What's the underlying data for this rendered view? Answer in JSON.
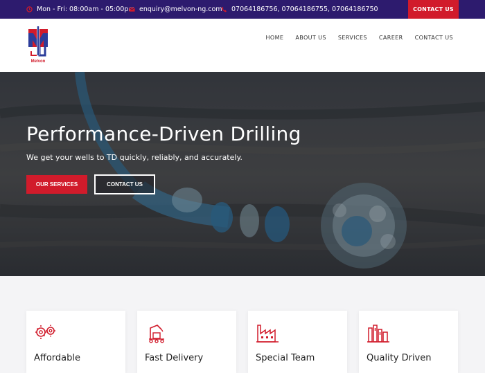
{
  "topbar": {
    "hours": "Mon - Fri: 08:00am - 05:00pm",
    "email": "enquiry@melvon-ng.com",
    "phones": "07064186756, 07064186755, 07064186750",
    "contact_button": "CONTACT US"
  },
  "header": {
    "logo_text": "Melvon",
    "nav": [
      "HOME",
      "ABOUT US",
      "SERVICES",
      "CAREER",
      "CONTACT US"
    ]
  },
  "hero": {
    "title": "Performance-Driven Drilling",
    "subtitle": "We get your wells to TD quickly, reliably, and accurately.",
    "primary_button": "OUR SERVICES",
    "secondary_button": "CONTACT US"
  },
  "features": [
    {
      "title": "Affordable",
      "icon": "gears-icon"
    },
    {
      "title": "Fast Delivery",
      "icon": "conveyor-robot-icon"
    },
    {
      "title": "Special Team",
      "icon": "factory-icon"
    },
    {
      "title": "Quality Driven",
      "icon": "refinery-icon"
    }
  ],
  "colors": {
    "topbar_bg": "#2d1b6e",
    "accent_red": "#d11b2b",
    "logo_blue": "#2b3c9a"
  }
}
